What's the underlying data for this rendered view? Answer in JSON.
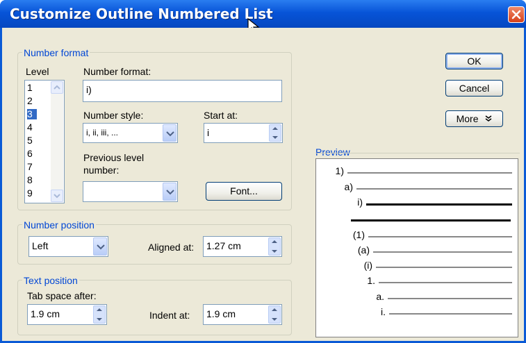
{
  "window": {
    "title": "Customize Outline Numbered List"
  },
  "number_format_group": {
    "title": "Number format",
    "level_label": "Level",
    "levels": [
      "1",
      "2",
      "3",
      "4",
      "5",
      "6",
      "7",
      "8",
      "9"
    ],
    "selected_level": "3",
    "number_format_label": "Number format:",
    "number_format_value": "i)",
    "number_style_label": "Number style:",
    "number_style_value": "i, ii, iii, ...",
    "start_at_label": "Start at:",
    "start_at_value": "i",
    "previous_level_label_line1": "Previous level",
    "previous_level_label_line2": "number:",
    "previous_level_value": "",
    "font_button": "Font..."
  },
  "number_position_group": {
    "title": "Number position",
    "alignment_value": "Left",
    "aligned_at_label": "Aligned at:",
    "aligned_at_value": "1.27 cm"
  },
  "text_position_group": {
    "title": "Text position",
    "tab_space_label": "Tab space after:",
    "tab_space_value": "1.9 cm",
    "indent_at_label": "Indent at:",
    "indent_at_value": "1.9 cm"
  },
  "buttons": {
    "ok": "OK",
    "cancel": "Cancel",
    "more": "More",
    "more_icon": "chevron-double-down-icon"
  },
  "preview": {
    "title": "Preview",
    "items": [
      "1)",
      "a)",
      "i)",
      "",
      "(1)",
      "(a)",
      "(i)",
      "1.",
      "a.",
      "i."
    ]
  }
}
